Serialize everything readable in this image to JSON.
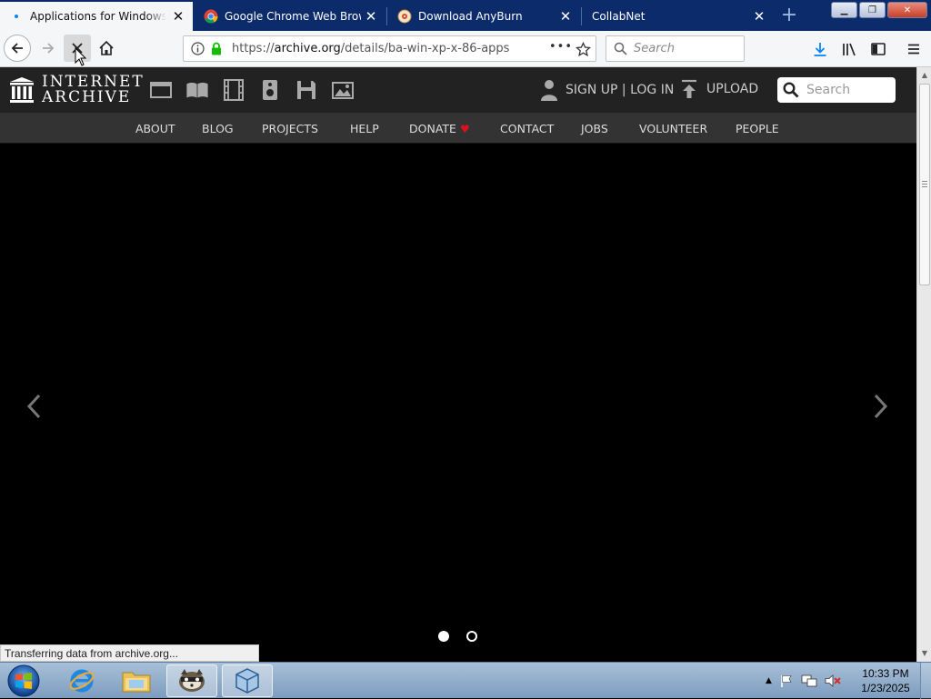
{
  "tabs": [
    {
      "title": "Applications for Windows XP",
      "icon": "firefox-loading-icon",
      "active": true
    },
    {
      "title": "Google Chrome Web Browser",
      "icon": "chrome-icon",
      "active": false
    },
    {
      "title": "Download AnyBurn",
      "icon": "anyburn-icon",
      "active": false
    },
    {
      "title": "CollabNet",
      "icon": "none",
      "active": false
    }
  ],
  "toolbar": {
    "url_prefix": "https://",
    "url_host": "archive.org",
    "url_path": "/details/ba-win-xp-x-86-apps",
    "search_placeholder": "Search",
    "page_actions": "•••"
  },
  "site": {
    "logo_line1": "INTERNET",
    "logo_line2": "ARCHIVE",
    "signin": "SIGN UP | LOG IN",
    "upload": "UPLOAD",
    "search_placeholder": "Search",
    "media_icons": [
      "web-icon",
      "texts-icon",
      "video-icon",
      "audio-icon",
      "software-icon",
      "images-icon"
    ],
    "nav": [
      "ABOUT",
      "BLOG",
      "PROJECTS",
      "HELP",
      "DONATE",
      "CONTACT",
      "JOBS",
      "VOLUNTEER",
      "PEOPLE"
    ],
    "donate_heart": "♥",
    "carousel_dots": 2,
    "carousel_active": 0
  },
  "status": "Transferring data from archive.org...",
  "taskbar": {
    "apps": [
      "internet-explorer-icon",
      "file-explorer-icon",
      "raccoon-app-icon",
      "virtualbox-icon"
    ],
    "clock_time": "10:33 PM",
    "clock_date": "1/23/2025"
  },
  "colors": {
    "tabbar": "#0c2b6b",
    "ia_header": "#222222",
    "ia_nav": "#333333",
    "secure_lock": "#12bc00",
    "download_arrow": "#0a84ff",
    "donate_heart": "#e0101f"
  }
}
